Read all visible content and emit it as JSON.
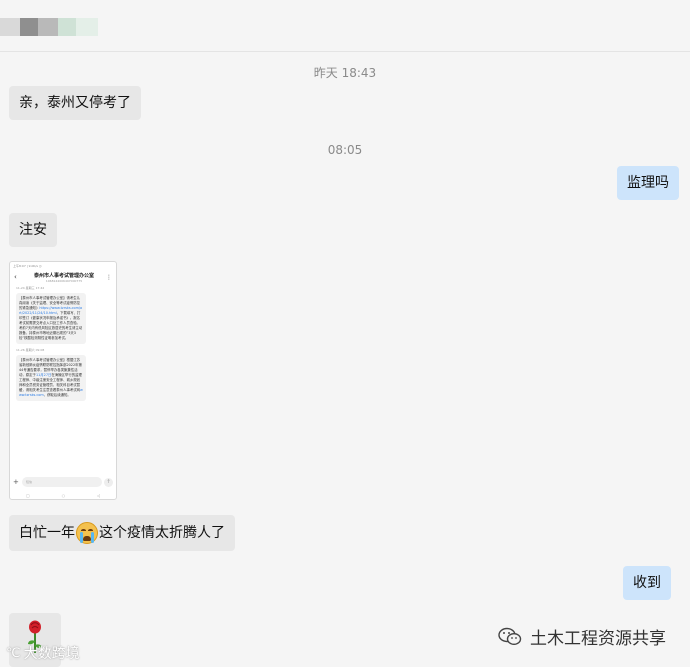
{
  "header": {
    "title_obscured": true
  },
  "messages": [
    {
      "kind": "time",
      "text": "昨天 18:43"
    },
    {
      "kind": "left",
      "text": "亲，泰州又停考了"
    },
    {
      "kind": "time",
      "text": "08:05"
    },
    {
      "kind": "right",
      "text": "监理吗"
    },
    {
      "kind": "left",
      "text": "注安"
    },
    {
      "kind": "left",
      "text_before": "白忙一年",
      "text_after": "这个疫情太折腾人了",
      "emoji": "crying-face-icon"
    },
    {
      "kind": "right",
      "text": "收到"
    }
  ],
  "screenshot": {
    "status_bar": "上午8:07 | 9.0K/s ◷",
    "title": "泰州市人事考试管理办公室",
    "subtitle": "1068144006497000775",
    "back_icon": "‹",
    "more_icon": "⋮",
    "msg1_time": "11-24 星期三 17:42",
    "msg1_text": "【泰州市人事考试管理办公室】请考生认真阅读《关于监理、安全等考试疫情防控的紧急通知》",
    "msg1_link": "https://www.tzrsks.com/art/2022/11/24/10.html",
    "msg1_text2": "，下载填写、打印签订《健康状况申报及承诺书》。报名考试前需提交考点入口处工作人员查验。考前7天内有低风险区旅居史的考生请主动报备，持泰州市等地近期出现的“3天3检”核酸检测阴性证明参加考试。",
    "msg2_time": "11-26 星期六 09:08",
    "msg2_text": "【泰州市人事考试管理办公室】根据江苏省新冠肺炎疫情联防联控指挥部2022年第44号通告要求，暂停举办各类聚集性活动，原定于",
    "msg2_link": "11月27日",
    "msg2_text2": "在海陵区举行的监理工程师、中级注册安全工程师、城乡规划师和全员税务证管理员、相关科目考试暂缓，请相关考生注意查看泰州人事考试网",
    "msg2_link2": "www.tzrsks.com",
    "msg2_text3": "，获取后续通知。",
    "input_placeholder": "短信",
    "plus_icon": "+",
    "send_icon": "↑",
    "nav": [
      "▢",
      "○",
      "◁"
    ]
  },
  "rose_icon": "rose-icon",
  "watermark_left": "大数跨境",
  "watermark_right": "土木工程资源共享",
  "colors": {
    "left_bubble": "#e7e7e7",
    "right_bubble": "#cde4fb",
    "background": "#f5f5f5"
  }
}
